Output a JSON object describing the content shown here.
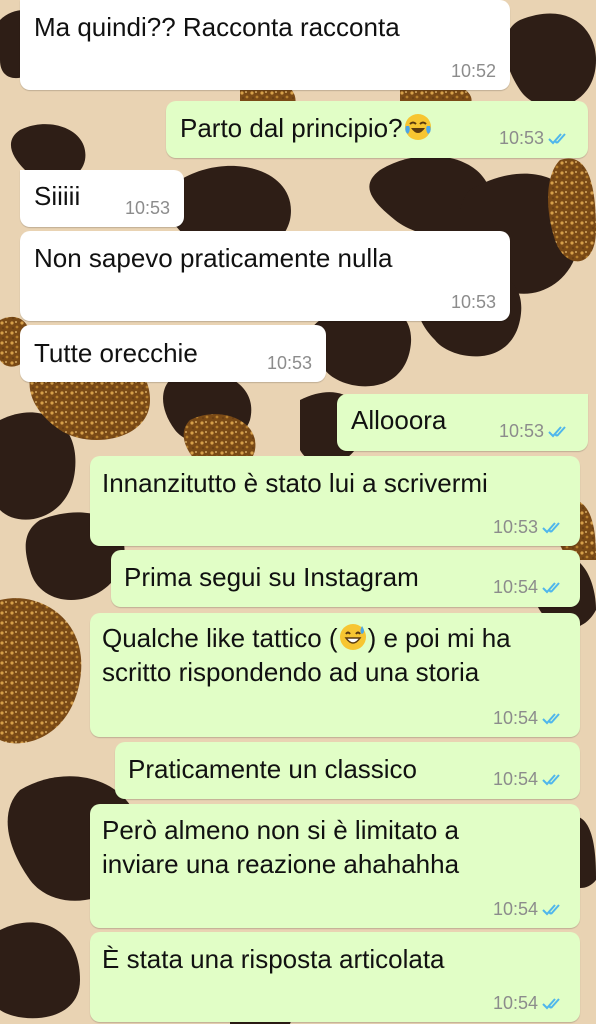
{
  "colors": {
    "incoming_bubble": "#ffffff",
    "outgoing_bubble": "#e1fec6",
    "read_ticks": "#4fb6ec",
    "timestamp": "#8c8c8c",
    "wallpaper_base": "#e9d3b3",
    "wallpaper_spots": "#2e1e16",
    "wallpaper_glitter": "#8a5a1e"
  },
  "icons": {
    "read_receipt": "double-check-icon",
    "laugh_emoji": "tears-of-joy-emoji-icon",
    "sweat_smile_emoji": "grinning-sweat-emoji-icon"
  },
  "messages": [
    {
      "dir": "in",
      "text": "Ma quindi?? Racconta racconta",
      "time": "10:52"
    },
    {
      "dir": "out",
      "text": "Parto dal principio?",
      "time": "10:53",
      "read": true
    },
    {
      "dir": "in",
      "text": "Siiiii",
      "time": "10:53"
    },
    {
      "dir": "in",
      "text": "Non sapevo praticamente nulla",
      "time": "10:53"
    },
    {
      "dir": "in",
      "text": "Tutte orecchie",
      "time": "10:53"
    },
    {
      "dir": "out",
      "text": "Allooora",
      "time": "10:53",
      "read": true
    },
    {
      "dir": "out",
      "text": "Innanzitutto è stato lui a scrivermi",
      "time": "10:53",
      "read": true
    },
    {
      "dir": "out",
      "text": "Prima segui su Instagram",
      "time": "10:54",
      "read": true
    },
    {
      "dir": "out",
      "text_line1_before_emoji": "Qualche like tattico (",
      "text_line1_after_emoji": ") e poi mi ha",
      "text_line2": "scritto rispondendo ad una storia",
      "time": "10:54",
      "read": true
    },
    {
      "dir": "out",
      "text": "Praticamente un classico",
      "time": "10:54",
      "read": true
    },
    {
      "dir": "out",
      "text_line1": "Però almeno non si è limitato a",
      "text_line2": "inviare una reazione ahahahha",
      "time": "10:54",
      "read": true
    },
    {
      "dir": "out",
      "text": "È stata una risposta articolata",
      "time": "10:54",
      "read": true
    }
  ]
}
